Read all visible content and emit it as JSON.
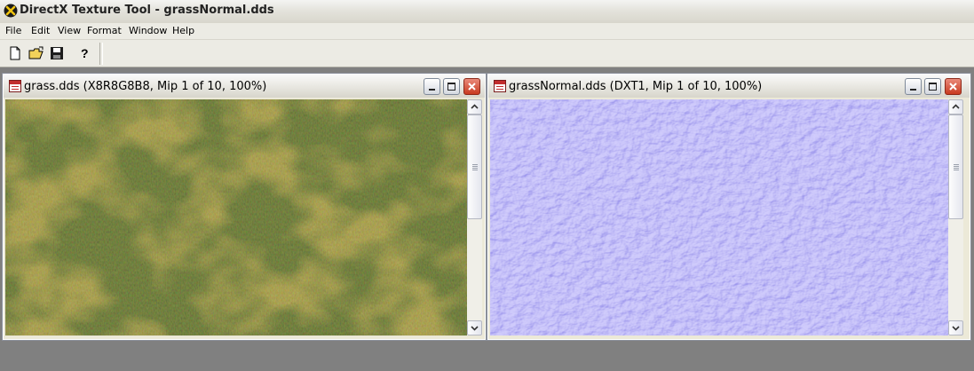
{
  "app": {
    "title": "DirectX Texture Tool - grassNormal.dds"
  },
  "menu": [
    "File",
    "Edit",
    "View",
    "Format",
    "Window",
    "Help"
  ],
  "toolbar": {
    "buttons": [
      "new-icon",
      "open-icon",
      "save-icon",
      "help-icon"
    ]
  },
  "documents": [
    {
      "title": "grass.dds (X8R8G8B8, Mip 1 of 10, 100%)",
      "texture": "grass-diffuse"
    },
    {
      "title": "grassNormal.dds (DXT1, Mip 1 of 10, 100%)",
      "texture": "grass-normal-map"
    }
  ],
  "colors": {
    "mdi_background": "#808080",
    "grass_base": "#6b7a2e",
    "grass_dry": "#b9a56a",
    "normal_base": "#7f7cf2"
  }
}
